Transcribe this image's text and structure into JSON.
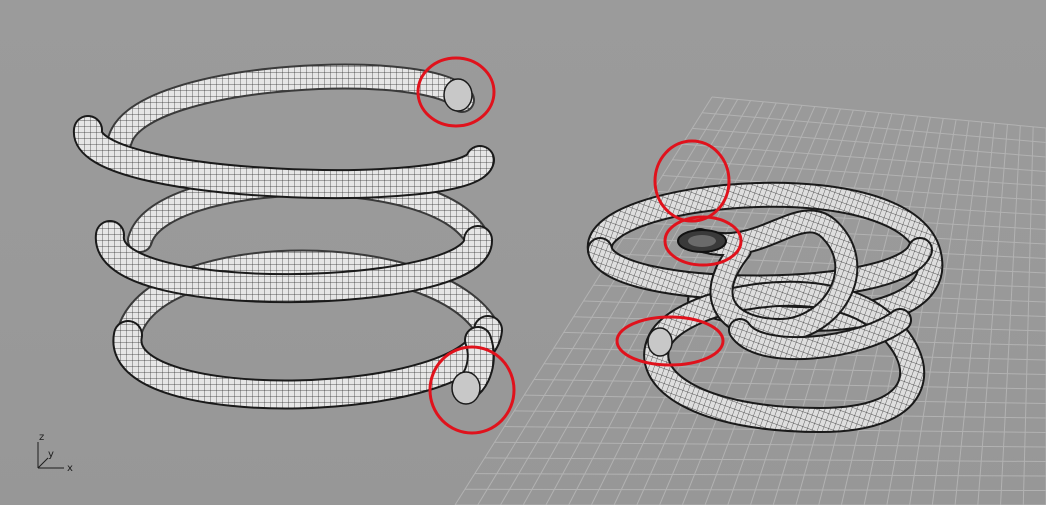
{
  "viewport": {
    "background_color": "#9a9a9a",
    "grid_color": "#b2b2b2",
    "object_fill": "#e4e4e4",
    "mesh_color": "#1a1a1a",
    "highlight_color": "#e0121c"
  },
  "axes": {
    "z_label": "z",
    "y_label": "y",
    "x_label": "x"
  },
  "objects": [
    {
      "name": "helix-spring-open-ends",
      "type": "coil-pipe",
      "turns": 3,
      "highlighted_ends": 2
    },
    {
      "name": "knotted-pipe",
      "type": "knot-pipe",
      "highlighted_ends": 3
    }
  ]
}
